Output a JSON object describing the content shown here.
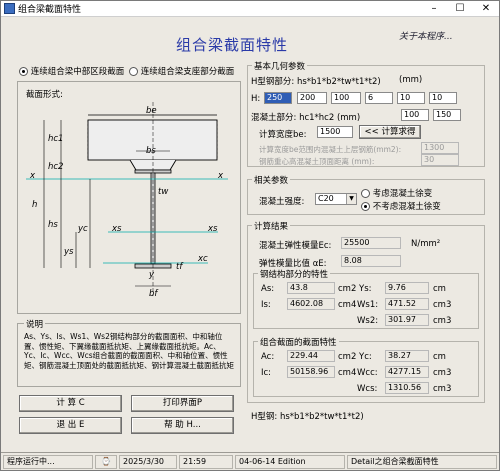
{
  "window": {
    "title": "组合梁截面特性",
    "min": "–",
    "max": "☐",
    "close": "✕"
  },
  "header": {
    "title": "组合梁截面特性",
    "about": "关于本程序..."
  },
  "section_radio": {
    "opt1": "连续组合梁中部区段截面",
    "opt2": "连续组合梁支座部分截面"
  },
  "diagram": {
    "label": "截面形式:",
    "be": "be",
    "bs": "bs",
    "hc1": "hc1",
    "hc2": "hc2",
    "h": "h",
    "hs": "hs",
    "ys": "ys",
    "yc": "yc",
    "tw": "tw",
    "x": "x",
    "xs": "xs",
    "xc": "xc",
    "tf": "tf",
    "y": "y",
    "bf": "bf"
  },
  "explain": {
    "title": "说明",
    "text": "As、Ys、Is、Ws1、Ws2钢结构部分的截面面积、中和轴位置、惯性矩、下翼缘截面抵抗矩、上翼缘截面抵抗矩。Ac、Yc、Ic、Wcc、Wcs组合截面的截面面积、中和轴位置、惯性矩、钢筋混凝土顶面处的截面抵抗矩、钢计算混凝土截面抵抗矩"
  },
  "buttons": {
    "calc": "计 算 C",
    "print": "打印界面P",
    "exit": "退 出 E",
    "help": "帮 助 H..."
  },
  "geometry": {
    "title": "基本几何参数",
    "steel_label": "H型钢部分: hs*b1*b2*tw*t1*t2)",
    "steel_unit": "(mm)",
    "h_label": "H:",
    "steel_values": [
      "250",
      "200",
      "100",
      "6",
      "10",
      "10"
    ],
    "concrete_label": "混凝土部分: hc1*hc2 (mm)",
    "concrete_values": [
      "100",
      "150"
    ],
    "width_label": "计算宽度be:",
    "width_value": "1500",
    "width_button": "<< 计算求得",
    "rebar_label": "计算宽度be范围内混凝土上层钢筋(mm2):",
    "rebar_value": "1300",
    "rebar_dist_label": "钢筋重心高混凝土顶面距离 (mm):",
    "rebar_dist_value": "30"
  },
  "params": {
    "title": "相关参数",
    "grade_label": "混凝土强度:",
    "grade_value": "C20",
    "opt_consider": "考虑混凝土徐变",
    "opt_noconsider": "不考虑混凝土徐变"
  },
  "results": {
    "title": "计算结果",
    "ec_label": "混凝土弹性模量Ec:",
    "ec_value": "25500",
    "ec_unit": "N/mm²",
    "ratio_label": "弹性模量比值 αE:",
    "ratio_value": "8.08",
    "steel": {
      "title": "钢结构部分的特性",
      "as_label": "As:",
      "as_value": "43.8",
      "as_unit": "cm2",
      "ys_label": "Ys:",
      "ys_value": "9.76",
      "ys_unit": "cm",
      "is_label": "Is:",
      "is_value": "4602.08",
      "is_unit": "cm4",
      "ws1_label": "Ws1:",
      "ws1_value": "471.52",
      "ws1_unit": "cm3",
      "ws2_label": "Ws2:",
      "ws2_value": "301.97",
      "ws2_unit": "cm3"
    },
    "comp": {
      "title": "组合截面的截面特性",
      "ac_label": "Ac:",
      "ac_value": "229.44",
      "ac_unit": "cm2",
      "yc_label": "Yc:",
      "yc_value": "38.27",
      "yc_unit": "cm",
      "ic_label": "Ic:",
      "ic_value": "50158.96",
      "ic_unit": "cm4",
      "wcc_label": "Wcc:",
      "wcc_value": "4277.15",
      "wcc_unit": "cm3",
      "wcs_label": "Wcs:",
      "wcs_value": "1310.56",
      "wcs_unit": "cm3"
    }
  },
  "hint": "H型钢: hs*b1*b2*tw*t1*t2)",
  "status": {
    "running": "程序运行中...",
    "date": "2025/3/30",
    "time": "21:59",
    "edition": "04-06-14 Edition",
    "detail": "Detail之组合梁截面特性"
  }
}
